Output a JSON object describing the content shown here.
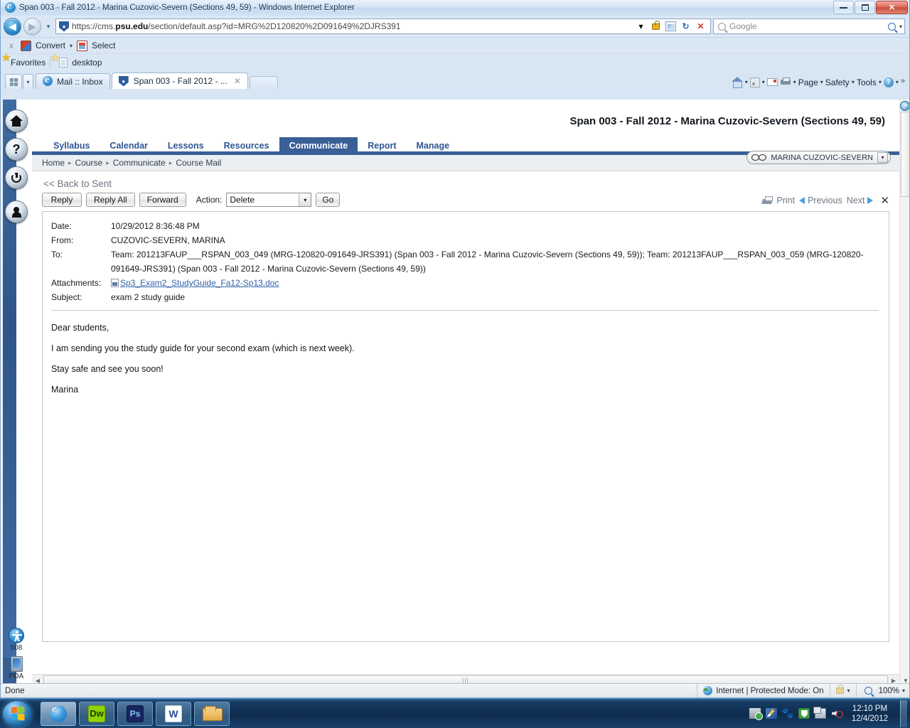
{
  "window": {
    "title": "Span 003 - Fall 2012 - Marina Cuzovic-Severn (Sections 49, 59) - Windows Internet Explorer",
    "minimize": "—",
    "maximize": "❐",
    "close": "✕"
  },
  "address_bar": {
    "url_prefix": "https://cms.",
    "url_domain": "psu.edu",
    "url_suffix": "/section/default.asp?id=MRG%2D120820%2D091649%2DJRS391",
    "dropdown": "▾",
    "lock_icon": "lock-icon",
    "compat_icon": "compatibility-view-icon",
    "refresh_icon": "↻",
    "stop_icon": "✕",
    "search_placeholder": "Google"
  },
  "command_bar": {
    "close": "x",
    "convert": "Convert",
    "select": "Select",
    "caret": "▾"
  },
  "favorites_bar": {
    "favorites": "Favorites",
    "desktop": "desktop"
  },
  "tabs": {
    "quick_tabs": "quick-tabs",
    "dropdown_caret": "▾",
    "items": [
      {
        "label": "Mail :: Inbox",
        "active": false
      },
      {
        "label": "Span 003 - Fall 2012 - ...",
        "active": true,
        "close": "✕"
      }
    ]
  },
  "command_icons": {
    "home": "home-icon",
    "feeds": "rss-icon",
    "read_mail": "mail-icon",
    "print": "print-icon",
    "page": "Page",
    "safety": "Safety",
    "tools": "Tools",
    "help": "?",
    "caret": "▾",
    "overflow": "»"
  },
  "dock": {
    "buttons": [
      {
        "name": "home",
        "glyph": "home-icon"
      },
      {
        "name": "help",
        "glyph": "?"
      },
      {
        "name": "logout",
        "glyph": "power-icon"
      },
      {
        "name": "profile",
        "glyph": "person-icon"
      }
    ],
    "accessibility_label": "508",
    "pda_label": "PDA"
  },
  "course": {
    "title": "Span 003 - Fall 2012 - Marina Cuzovic-Severn (Sections 49, 59)",
    "nav": [
      {
        "label": "Syllabus",
        "active": false
      },
      {
        "label": "Calendar",
        "active": false
      },
      {
        "label": "Lessons",
        "active": false
      },
      {
        "label": "Resources",
        "active": false
      },
      {
        "label": "Communicate",
        "active": true
      },
      {
        "label": "Report",
        "active": false
      },
      {
        "label": "Manage",
        "active": false
      }
    ],
    "breadcrumb": [
      "Home",
      "Course",
      "Communicate",
      "Course Mail"
    ],
    "breadcrumb_sep": "▸",
    "user": "MARINA CUZOVIC-SEVERN",
    "user_caret": "▾"
  },
  "mail": {
    "back_link": "<< Back to Sent",
    "buttons": {
      "reply": "Reply",
      "reply_all": "Reply All",
      "forward": "Forward",
      "go": "Go"
    },
    "action_label": "Action:",
    "action_value": "Delete",
    "action_caret": "▾",
    "right_tools": {
      "print": "Print",
      "previous": "Previous",
      "next": "Next",
      "close": "✕"
    },
    "fields": {
      "date_label": "Date:",
      "date_value": "10/29/2012 8:36:48 PM",
      "from_label": "From:",
      "from_value": "CUZOVIC-SEVERN, MARINA",
      "to_label": "To:",
      "to_value": "Team: 201213FAUP___RSPAN_003_049 (MRG-120820-091649-JRS391) (Span 003 - Fall 2012 - Marina Cuzovic-Severn (Sections 49, 59)); Team: 201213FAUP___RSPAN_003_059 (MRG-120820-091649-JRS391) (Span 003 - Fall 2012 - Marina Cuzovic-Severn (Sections 49, 59))",
      "attachments_label": "Attachments:",
      "attachment_file": "Sp3_Exam2_StudyGuide_Fa12-Sp13.doc",
      "subject_label": "Subject:",
      "subject_value": "exam 2 study guide"
    },
    "body": [
      "Dear students,",
      "I am sending you the study guide for your second exam (which is next week).",
      "Stay safe and see you soon!",
      "Marina"
    ]
  },
  "status_bar": {
    "status": "Done",
    "zone": "Internet | Protected Mode: On",
    "zoom": "100%",
    "caret": "▾"
  },
  "taskbar": {
    "items": [
      {
        "label": "Internet Explorer",
        "icon": "ie-icon",
        "active": true
      },
      {
        "label": "Dreamweaver",
        "icon": "dw-icon",
        "active": false
      },
      {
        "label": "Photoshop",
        "icon": "ps-icon",
        "active": false
      },
      {
        "label": "Microsoft Word",
        "icon": "word-icon",
        "active": false
      },
      {
        "label": "Windows Explorer",
        "icon": "folder-icon",
        "active": false
      }
    ],
    "tray": [
      "network-icon",
      "pen-icon",
      "paw-icon",
      "shield-icon",
      "monitor-icon",
      "speaker-muted-icon"
    ],
    "time": "12:10 PM",
    "date": "12/4/2012"
  }
}
